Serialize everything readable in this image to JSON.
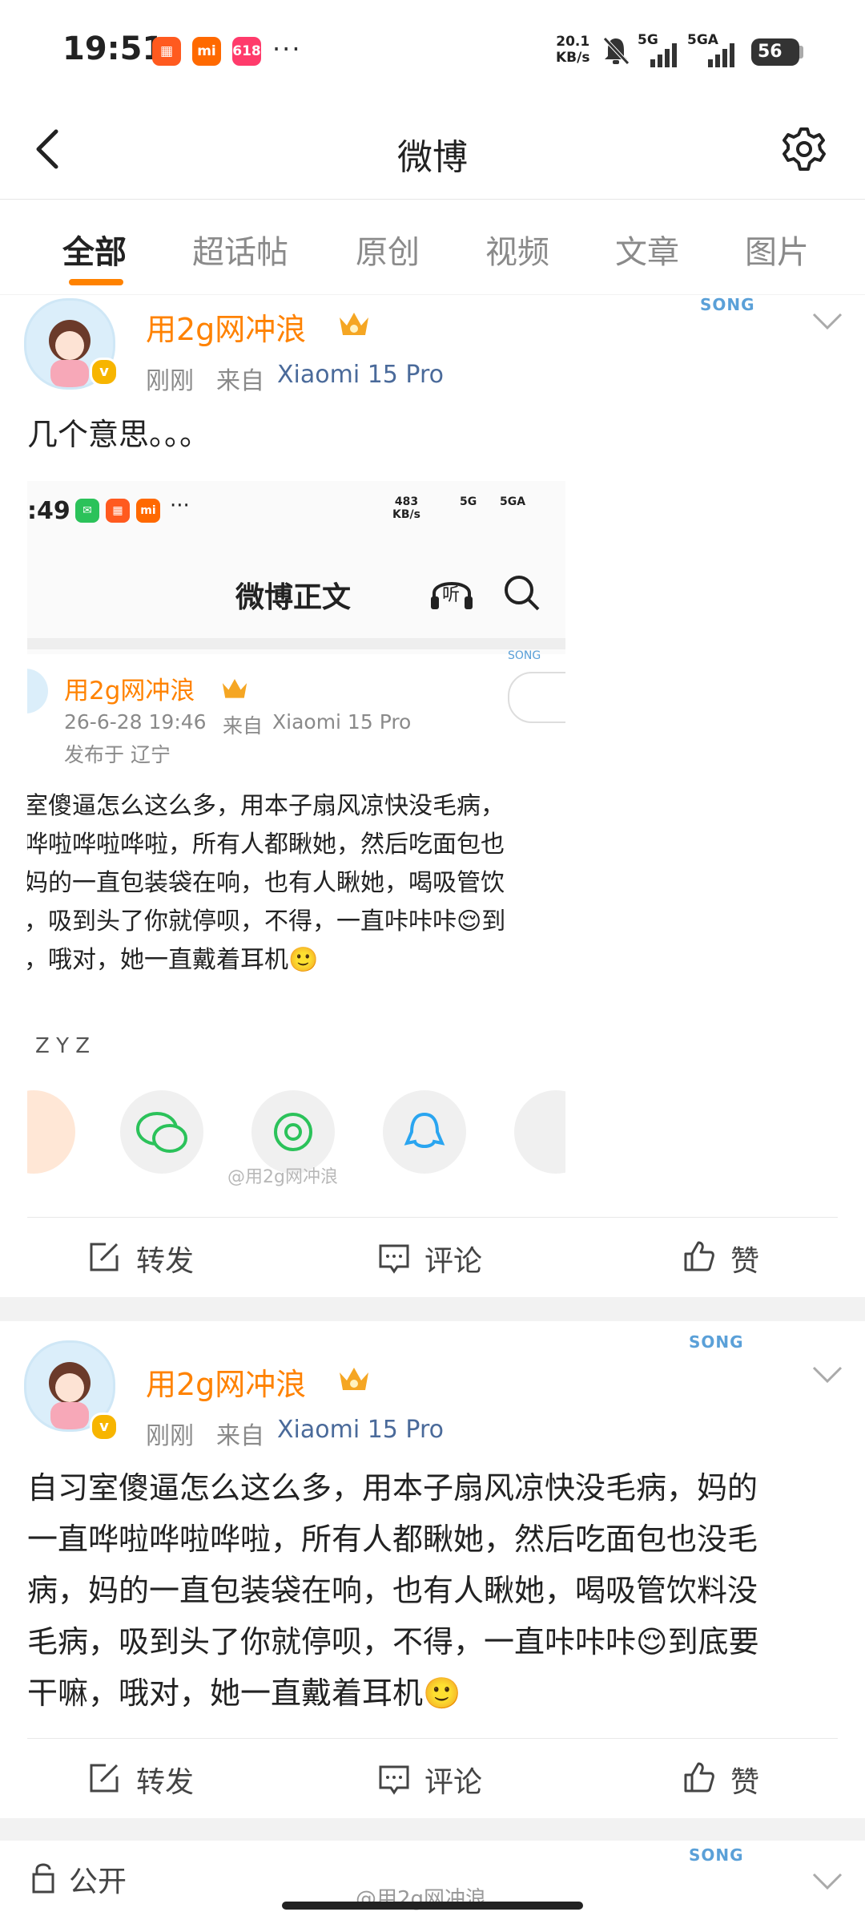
{
  "status_bar": {
    "time": "19:51",
    "app_icons": [
      "hongbao-app-icon",
      "mi-app-icon",
      "618-app-icon"
    ],
    "more": "···",
    "speed_value": "20.1",
    "speed_unit": "KB/s",
    "sim1": "5G",
    "sim2": "5GA",
    "battery": "56"
  },
  "header": {
    "title": "微博"
  },
  "tabs": [
    "全部",
    "超话帖",
    "原创",
    "视频",
    "文章",
    "图片"
  ],
  "post1": {
    "username": "用2g网冲浪",
    "time": "刚刚",
    "source_label": "来自",
    "source": "Xiaomi 15 Pro",
    "text": "几个意思。。。",
    "actions": {
      "repost": "转发",
      "comment": "评论",
      "like": "赞"
    }
  },
  "embedded": {
    "time": ":49",
    "speed_value": "483",
    "speed_unit": "KB/s",
    "sim1": "5G",
    "sim2": "5GA",
    "title": "微博正文",
    "listen": "听",
    "username": "用2g网冲浪",
    "datetime": "26-6-28 19:46",
    "source_label": "来自",
    "source": "Xiaomi 15 Pro",
    "location": "发布于 辽宁",
    "lines": [
      "室傻逼怎么这么多，用本子扇风凉快没毛病，",
      "哗啦哗啦哗啦，所有人都瞅她，然后吃面包也",
      "妈的一直包装袋在响，也有人瞅她，喝吸管饮",
      "，吸到头了你就停呗，不得，一直咔咔咔😌到",
      "，哦对，她一直戴着耳机🙂"
    ],
    "zyz": "Z Y Z",
    "watermark": "@用2g网冲浪"
  },
  "post2": {
    "username": "用2g网冲浪",
    "time": "刚刚",
    "source_label": "来自",
    "source": "Xiaomi 15 Pro",
    "lines": [
      "自习室傻逼怎么这么多，用本子扇风凉快没毛病，妈的",
      "一直哗啦哗啦哗啦，所有人都瞅她，然后吃面包也没毛",
      "病，妈的一直包装袋在响，也有人瞅她，喝吸管饮料没",
      "毛病，吸到头了你就停呗，不得，一直咔咔咔😌到底要",
      "干嘛，哦对，她一直戴着耳机🙂"
    ],
    "actions": {
      "repost": "转发",
      "comment": "评论",
      "like": "赞"
    }
  },
  "post3": {
    "visibility": "公开"
  },
  "deco_text": "SONG",
  "watermark": "@用2g网冲浪",
  "colors": {
    "accent": "#ff8200",
    "link": "#4a6a9a",
    "text": "#222222",
    "muted": "#8a8a8a"
  }
}
